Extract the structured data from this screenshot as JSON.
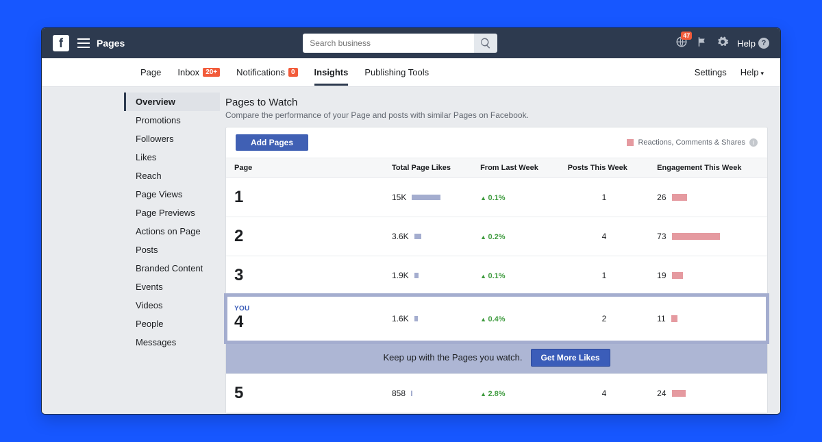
{
  "top": {
    "app_label": "Pages",
    "search_placeholder": "Search business",
    "notif_badge": "47",
    "help_label": "Help"
  },
  "nav": {
    "tabs": [
      "Page",
      "Inbox",
      "Notifications",
      "Insights",
      "Publishing Tools"
    ],
    "inbox_badge": "20+",
    "notif_badge": "0",
    "active": "Insights",
    "settings": "Settings",
    "help": "Help"
  },
  "sidebar": {
    "items": [
      "Overview",
      "Promotions",
      "Followers",
      "Likes",
      "Reach",
      "Page Views",
      "Page Previews",
      "Actions on Page",
      "Posts",
      "Branded Content",
      "Events",
      "Videos",
      "People",
      "Messages"
    ],
    "active": "Overview"
  },
  "panel": {
    "title": "Pages to Watch",
    "desc": "Compare the performance of your Page and posts with similar Pages on Facebook.",
    "add_btn": "Add Pages",
    "legend": "Reactions, Comments & Shares",
    "cols": [
      "Page",
      "Total Page Likes",
      "From Last Week",
      "Posts This Week",
      "Engagement This Week"
    ],
    "cta_text": "Keep up with the Pages you watch.",
    "cta_btn": "Get More Likes",
    "you_label": "YOU"
  },
  "chart_data": {
    "type": "table",
    "columns": [
      "rank",
      "total_page_likes",
      "likes_bar",
      "from_last_week_pct",
      "posts_this_week",
      "engagement_this_week",
      "engagement_bar",
      "is_you"
    ],
    "rows": [
      {
        "rank": "1",
        "total_page_likes": "15K",
        "likes_bar": 42,
        "from_last_week_pct": "0.1%",
        "posts_this_week": "1",
        "engagement_this_week": "26",
        "engagement_bar": 22,
        "is_you": false
      },
      {
        "rank": "2",
        "total_page_likes": "3.6K",
        "likes_bar": 10,
        "from_last_week_pct": "0.2%",
        "posts_this_week": "4",
        "engagement_this_week": "73",
        "engagement_bar": 70,
        "is_you": false
      },
      {
        "rank": "3",
        "total_page_likes": "1.9K",
        "likes_bar": 6,
        "from_last_week_pct": "0.1%",
        "posts_this_week": "1",
        "engagement_this_week": "19",
        "engagement_bar": 16,
        "is_you": false
      },
      {
        "rank": "4",
        "total_page_likes": "1.6K",
        "likes_bar": 5,
        "from_last_week_pct": "0.4%",
        "posts_this_week": "2",
        "engagement_this_week": "11",
        "engagement_bar": 9,
        "is_you": true
      },
      {
        "rank": "5",
        "total_page_likes": "858",
        "likes_bar": 2,
        "from_last_week_pct": "2.8%",
        "posts_this_week": "4",
        "engagement_this_week": "24",
        "engagement_bar": 20,
        "is_you": false
      }
    ]
  }
}
